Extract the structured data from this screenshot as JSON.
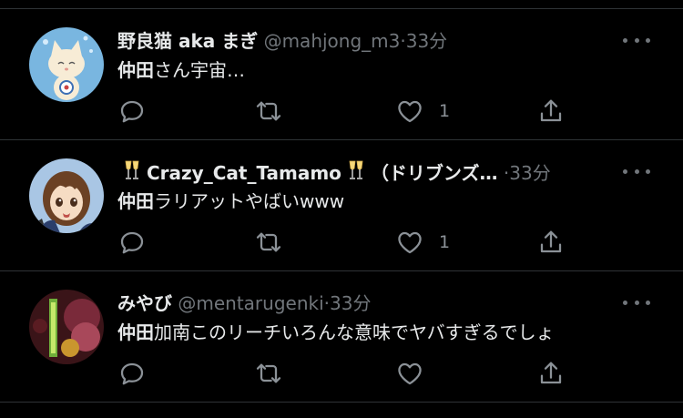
{
  "tweets": [
    {
      "display_name": "野良猫 aka まぎ",
      "handle": "@mahjong_m3",
      "dot": "·",
      "time": "33分",
      "mention": "仲田",
      "text": "さん宇宙…",
      "like_count": "1",
      "avatar": "cat-avatar"
    },
    {
      "display_name_prefix_icon": "champagne-glasses-icon",
      "display_name": "Crazy_Cat_Tamamo",
      "display_name_suffix_icon": "champagne-glasses-icon",
      "display_name_extra": "（ドリブンズ…",
      "dot": "·",
      "time": "33分",
      "mention": "仲田",
      "text": "ラリアットやばいwww",
      "like_count": "1",
      "avatar": "anime-character-avatar"
    },
    {
      "display_name": "みやび",
      "handle": "@mentarugenki",
      "dot": "·",
      "time": "33分",
      "mention": "仲田",
      "text": "加南このリーチいろんな意味でヤバすぎるでしょ",
      "like_count": "",
      "avatar": "game-art-avatar"
    }
  ],
  "icons": [
    "reply-icon",
    "retweet-icon",
    "like-icon",
    "share-icon",
    "more-options-icon"
  ],
  "colors": {
    "background": "#000000",
    "text": "#e7e9ea",
    "secondary": "#71767b",
    "divider": "#2f3336"
  }
}
